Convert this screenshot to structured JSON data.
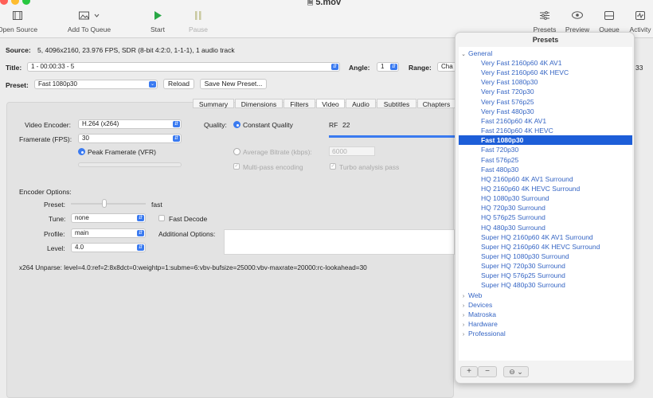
{
  "window": {
    "title": "5.mov"
  },
  "toolbar": {
    "open_source": "Open Source",
    "add_to_queue": "Add To Queue",
    "start": "Start",
    "pause": "Pause",
    "presets": "Presets",
    "preview": "Preview",
    "queue": "Queue",
    "activity": "Activity"
  },
  "source": {
    "label": "Source:",
    "info": "5, 4096x2160, 23.976 FPS, SDR (8-bit 4:2:0, 1-1-1), 1 audio track"
  },
  "title_row": {
    "label": "Title:",
    "value": "1 - 00:00:33 - 5",
    "angle_label": "Angle:",
    "angle_value": "1",
    "range_label": "Range:",
    "range_value": "Cha",
    "range_end": "33"
  },
  "preset_row": {
    "label": "Preset:",
    "value": "Fast 1080p30",
    "reload": "Reload",
    "save_new": "Save New Preset..."
  },
  "tabs": [
    "Summary",
    "Dimensions",
    "Filters",
    "Video",
    "Audio",
    "Subtitles",
    "Chapters"
  ],
  "selected_tab": "Video",
  "video": {
    "encoder_label": "Video Encoder:",
    "encoder_value": "H.264 (x264)",
    "framerate_label": "Framerate (FPS):",
    "framerate_value": "30",
    "peak_framerate": "Peak Framerate (VFR)",
    "quality_label": "Quality:",
    "constant_quality": "Constant Quality",
    "rf_label": "RF",
    "rf_value": "22",
    "avg_bitrate": "Average Bitrate (kbps):",
    "avg_bitrate_value": "6000",
    "multipass": "Multi-pass encoding",
    "turbo": "Turbo analysis pass"
  },
  "encoder_options": {
    "heading": "Encoder Options:",
    "preset_label": "Preset:",
    "preset_value": "fast",
    "tune_label": "Tune:",
    "tune_value": "none",
    "fast_decode": "Fast Decode",
    "profile_label": "Profile:",
    "profile_value": "main",
    "additional_label": "Additional Options:",
    "level_label": "Level:",
    "level_value": "4.0",
    "unparse": "x264 Unparse: level=4.0:ref=2:8x8dct=0:weightp=1:subme=6:vbv-bufsize=25000:vbv-maxrate=20000:rc-lookahead=30"
  },
  "presets_panel": {
    "title": "Presets",
    "general": "General",
    "items": [
      "Very Fast 2160p60 4K AV1",
      "Very Fast 2160p60 4K HEVC",
      "Very Fast 1080p30",
      "Very Fast 720p30",
      "Very Fast 576p25",
      "Very Fast 480p30",
      "Fast 2160p60 4K AV1",
      "Fast 2160p60 4K HEVC",
      "Fast 1080p30",
      "Fast 720p30",
      "Fast 576p25",
      "Fast 480p30",
      "HQ 2160p60 4K AV1 Surround",
      "HQ 2160p60 4K HEVC Surround",
      "HQ 1080p30 Surround",
      "HQ 720p30 Surround",
      "HQ 576p25 Surround",
      "HQ 480p30 Surround",
      "Super HQ 2160p60 4K AV1 Surround",
      "Super HQ 2160p60 4K HEVC Surround",
      "Super HQ 1080p30 Surround",
      "Super HQ 720p30 Surround",
      "Super HQ 576p25 Surround",
      "Super HQ 480p30 Surround"
    ],
    "selected_item": "Fast 1080p30",
    "groups": [
      "Web",
      "Devices",
      "Matroska",
      "Hardware",
      "Professional"
    ],
    "add": "+",
    "remove": "−",
    "options": "⊖ ⌄"
  },
  "colors": {
    "accent": "#1d5ed8",
    "link": "#3565c4"
  }
}
